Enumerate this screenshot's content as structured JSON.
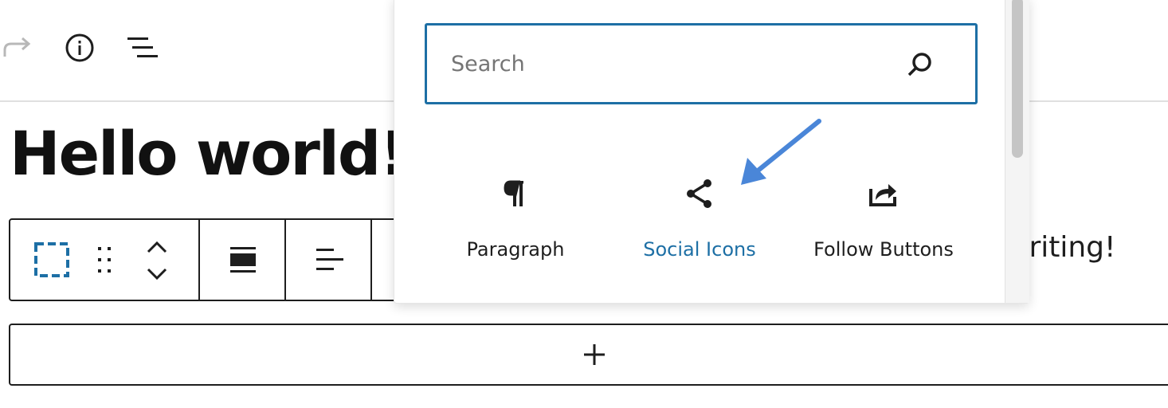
{
  "toolbar": {
    "redo_icon": "redo-icon",
    "info_icon": "info-icon",
    "outline_icon": "list-view-icon"
  },
  "post": {
    "title": "Hello world!",
    "paragraph_visible_text": "writing!"
  },
  "block_toolbar": {
    "icons": [
      "select-parent-icon",
      "drag-handle-icon",
      "move-up-icon",
      "move-down-icon",
      "align-wide-icon",
      "align-left-icon"
    ]
  },
  "inserter": {
    "search": {
      "placeholder": "Search",
      "value": ""
    },
    "blocks": [
      {
        "label": "Paragraph",
        "icon": "paragraph-icon",
        "color": "#1e1e1e"
      },
      {
        "label": "Social Icons",
        "icon": "share-icon",
        "color": "#1d6fa5"
      },
      {
        "label": "Follow Buttons",
        "icon": "share-box-icon",
        "color": "#1e1e1e"
      }
    ]
  },
  "appender": {
    "icon": "plus-icon"
  },
  "colors": {
    "accent": "#1d6fa5",
    "annotation_arrow": "#4a86d8"
  }
}
